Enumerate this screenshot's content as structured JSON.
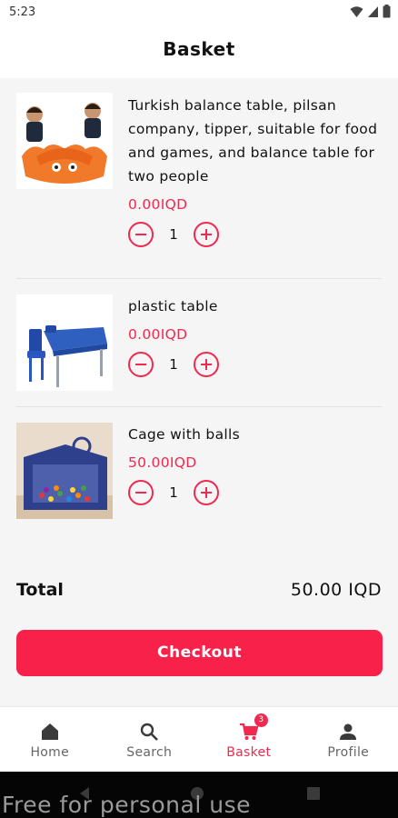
{
  "status_bar": {
    "time": "5:23"
  },
  "header": {
    "title": "Basket"
  },
  "items": [
    {
      "name": "Turkish balance table, pilsan company, tipper, suitable for food and games, and balance table for two people",
      "price": "0.00IQD",
      "quantity": "1",
      "image": "balance-table-image"
    },
    {
      "name": "plastic table",
      "price": "0.00IQD",
      "quantity": "1",
      "image": "plastic-table-image"
    },
    {
      "name": "Cage with balls",
      "price": "50.00IQD",
      "quantity": "1",
      "image": "ball-cage-image"
    }
  ],
  "summary": {
    "total_label": "Total",
    "total_value": "50.00 IQD"
  },
  "checkout_label": "Checkout",
  "bottom_nav": {
    "items": [
      {
        "label": "Home",
        "icon": "home-icon"
      },
      {
        "label": "Search",
        "icon": "search-icon"
      },
      {
        "label": "Basket",
        "icon": "cart-icon",
        "badge": "3",
        "active": true
      },
      {
        "label": "Profile",
        "icon": "profile-icon"
      }
    ]
  },
  "watermark": "Free for personal use",
  "colors": {
    "accent": "#f0294e",
    "checkout": "#f7214a",
    "background": "#f5f5f5"
  }
}
